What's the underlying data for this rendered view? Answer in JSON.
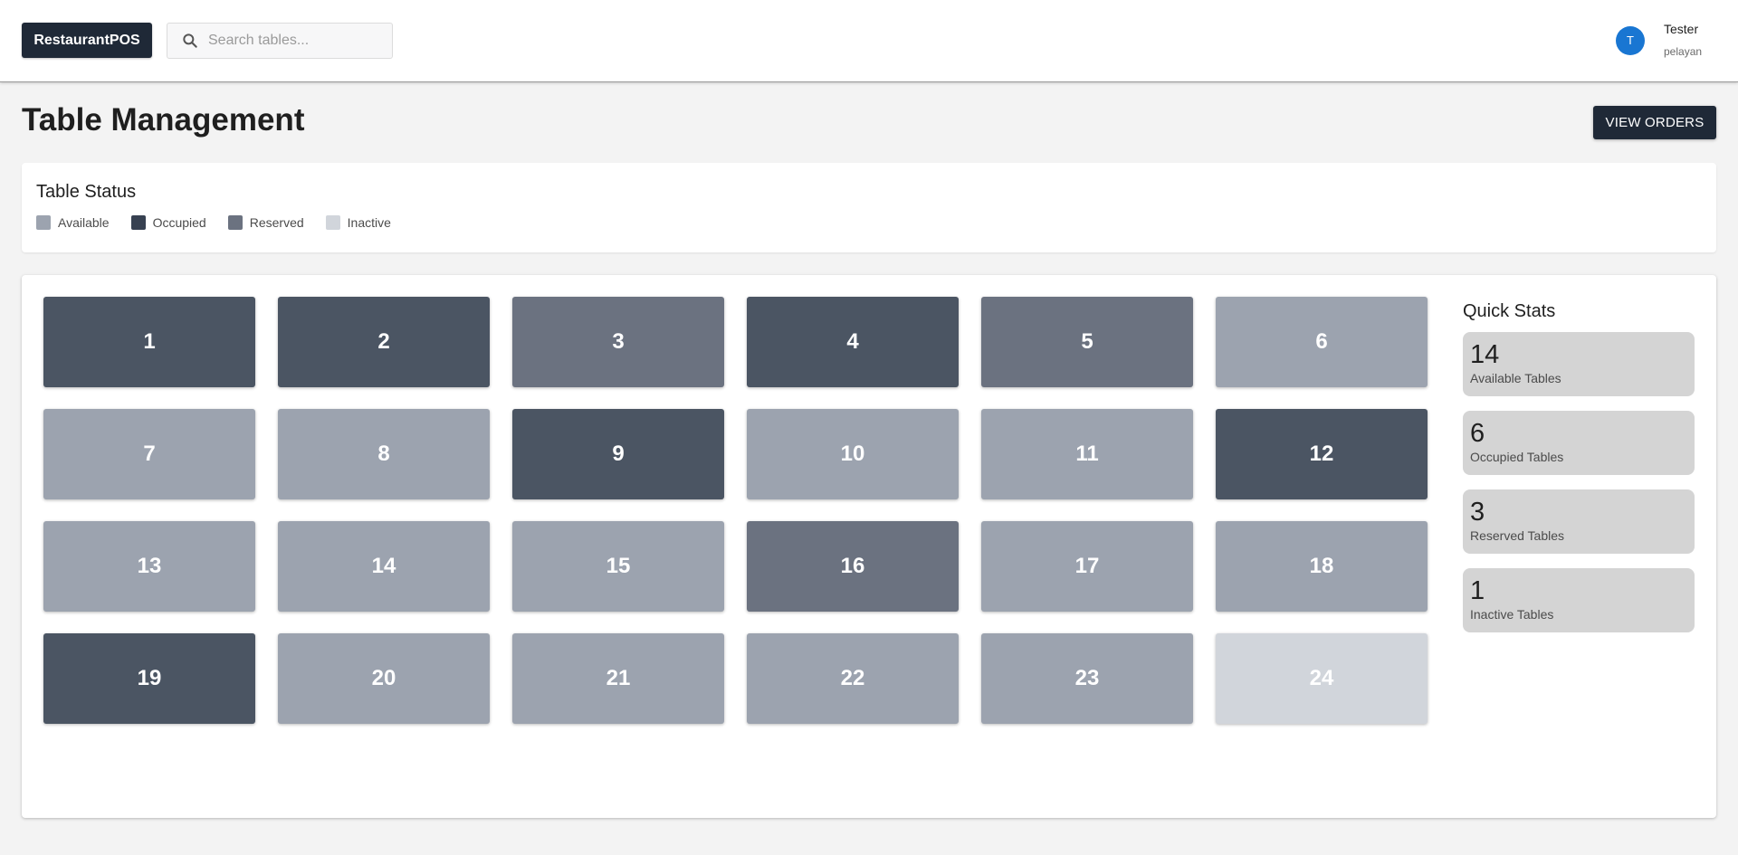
{
  "header": {
    "brand": "RestaurantPOS",
    "search_placeholder": "Search tables...",
    "user": {
      "avatar_initial": "T",
      "name": "Tester",
      "role": "pelayan"
    }
  },
  "page": {
    "title": "Table Management",
    "view_orders_label": "VIEW ORDERS"
  },
  "status_legend": {
    "title": "Table Status",
    "items": [
      {
        "label": "Available",
        "color": "#9ca3af"
      },
      {
        "label": "Occupied",
        "color": "#374151"
      },
      {
        "label": "Reserved",
        "color": "#6b7280"
      },
      {
        "label": "Inactive",
        "color": "#d1d5db"
      }
    ]
  },
  "status_colors": {
    "available": "#9ca3af",
    "occupied": "#4b5563",
    "reserved": "#6b7280",
    "inactive": "#d1d5db"
  },
  "tables": [
    {
      "number": "1",
      "status": "occupied"
    },
    {
      "number": "2",
      "status": "occupied"
    },
    {
      "number": "3",
      "status": "reserved"
    },
    {
      "number": "4",
      "status": "occupied"
    },
    {
      "number": "5",
      "status": "reserved"
    },
    {
      "number": "6",
      "status": "available"
    },
    {
      "number": "7",
      "status": "available"
    },
    {
      "number": "8",
      "status": "available"
    },
    {
      "number": "9",
      "status": "occupied"
    },
    {
      "number": "10",
      "status": "available"
    },
    {
      "number": "11",
      "status": "available"
    },
    {
      "number": "12",
      "status": "occupied"
    },
    {
      "number": "13",
      "status": "available"
    },
    {
      "number": "14",
      "status": "available"
    },
    {
      "number": "15",
      "status": "available"
    },
    {
      "number": "16",
      "status": "reserved"
    },
    {
      "number": "17",
      "status": "available"
    },
    {
      "number": "18",
      "status": "available"
    },
    {
      "number": "19",
      "status": "occupied"
    },
    {
      "number": "20",
      "status": "available"
    },
    {
      "number": "21",
      "status": "available"
    },
    {
      "number": "22",
      "status": "available"
    },
    {
      "number": "23",
      "status": "available"
    },
    {
      "number": "24",
      "status": "inactive"
    }
  ],
  "quick_stats": {
    "title": "Quick Stats",
    "items": [
      {
        "value": "14",
        "label": "Available Tables"
      },
      {
        "value": "6",
        "label": "Occupied Tables"
      },
      {
        "value": "3",
        "label": "Reserved Tables"
      },
      {
        "value": "1",
        "label": "Inactive Tables"
      }
    ]
  }
}
